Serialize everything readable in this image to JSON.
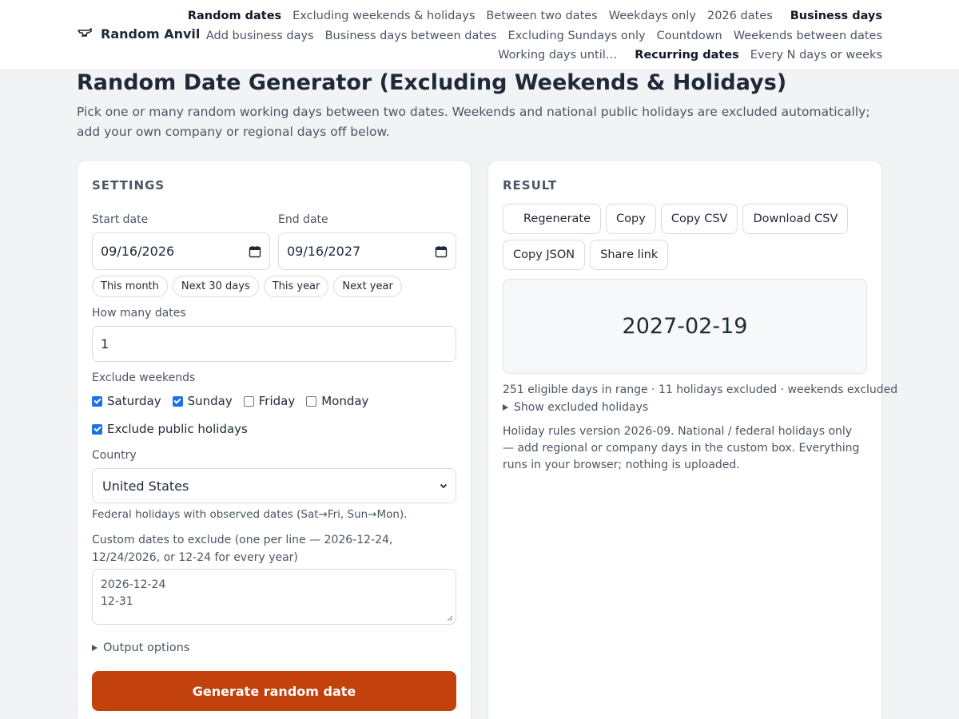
{
  "brand": {
    "name": "Random Anvil",
    "icon": "anvil-icon"
  },
  "nav": {
    "row1": [
      {
        "label": "Random dates",
        "bold": true
      },
      {
        "label": "Excluding weekends & holidays",
        "bold": false
      },
      {
        "label": "Between two dates",
        "bold": false
      },
      {
        "label": "Weekdays only",
        "bold": false
      },
      {
        "label": "2026 dates",
        "bold": false
      },
      {
        "label": "Business days",
        "bold": true
      }
    ],
    "row2": [
      {
        "label": "Add business days",
        "bold": false
      },
      {
        "label": "Business days between dates",
        "bold": false
      },
      {
        "label": "Excluding Sundays only",
        "bold": false
      },
      {
        "label": "Countdown",
        "bold": false
      },
      {
        "label": "Weekends between dates",
        "bold": false
      }
    ],
    "row3": [
      {
        "label": "Working days until…",
        "bold": false
      },
      {
        "label": "Recurring dates",
        "bold": true
      },
      {
        "label": "Every N days or weeks",
        "bold": false
      }
    ]
  },
  "page": {
    "title": "Random Date Generator (Excluding Weekends & Holidays)",
    "subtitle": "Pick one or many random working days between two dates. Weekends and national public holidays are excluded automatically; add your own company or regional days off below."
  },
  "settings": {
    "heading": "SETTINGS",
    "start_label": "Start date",
    "start_value": "09/16/2026",
    "end_label": "End date",
    "end_value": "09/16/2027",
    "presets": [
      "This month",
      "Next 30 days",
      "This year",
      "Next year"
    ],
    "count_label": "How many dates",
    "count_value": "1",
    "weekends_label": "Exclude weekends",
    "weekend_options": [
      {
        "label": "Saturday",
        "checked": true
      },
      {
        "label": "Sunday",
        "checked": true
      },
      {
        "label": "Friday",
        "checked": false
      },
      {
        "label": "Monday",
        "checked": false
      }
    ],
    "holidays_label": "Exclude public holidays",
    "holidays_checked": true,
    "country_label": "Country",
    "country_value": "United States",
    "country_note": "Federal holidays with observed dates (Sat→Fri, Sun→Mon).",
    "custom_label": "Custom dates to exclude (one per line — 2026-12-24, 12/24/2026, or 12-24 for every year)",
    "custom_lines": [
      "2026-12-24",
      "12-31"
    ],
    "output_options_label": "Output options",
    "generate_label": "Generate random date"
  },
  "result": {
    "heading": "RESULT",
    "buttons_row1": [
      "Regenerate",
      "Copy",
      "Copy CSV",
      "Download CSV"
    ],
    "buttons_row2": [
      "Copy JSON",
      "Share link"
    ],
    "value": "2027-02-19",
    "stats": "251 eligible days in range · 11 holidays excluded · weekends excluded",
    "show_excluded_label": "Show excluded holidays",
    "rules_note": "Holiday rules version 2026-09. National / federal holidays only — add regional or company days in the custom box. Everything runs in your browser; nothing is uploaded."
  },
  "colors": {
    "primary": "#c2410c",
    "checkbox": "#1a73e8"
  }
}
